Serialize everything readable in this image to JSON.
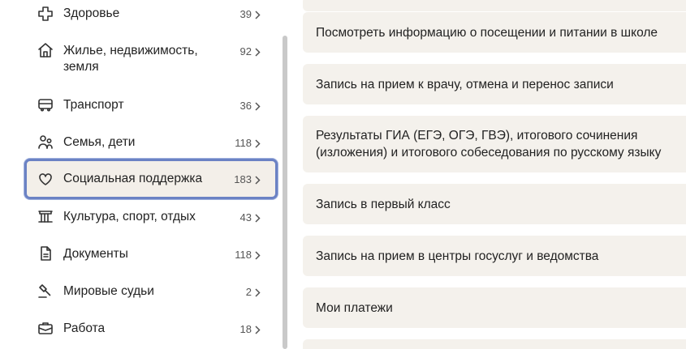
{
  "sidebar": {
    "items": [
      {
        "label": "Здоровье",
        "count": "39",
        "icon": "health-cross-icon"
      },
      {
        "label": "Жилье, недвижимость, земля",
        "count": "92",
        "icon": "house-icon"
      },
      {
        "label": "Транспорт",
        "count": "36",
        "icon": "bus-icon"
      },
      {
        "label": "Семья, дети",
        "count": "118",
        "icon": "family-icon"
      },
      {
        "label": "Социальная поддержка",
        "count": "183",
        "icon": "heart-hand-icon",
        "active": true
      },
      {
        "label": "Культура, спорт, отдых",
        "count": "43",
        "icon": "museum-icon"
      },
      {
        "label": "Документы",
        "count": "118",
        "icon": "document-icon"
      },
      {
        "label": "Мировые судьи",
        "count": "2",
        "icon": "gavel-icon"
      },
      {
        "label": "Работа",
        "count": "18",
        "icon": "briefcase-icon"
      }
    ]
  },
  "services": [
    "Посмотреть информацию о посещении и питании в школе",
    "Запись на прием к врачу, отмена и перенос записи",
    "Результаты ГИА (ЕГЭ, ОГЭ, ГВЭ), итогового сочинения (изложения) и итогового собеседования по русскому языку",
    "Запись в первый класс",
    "Запись на прием в центры госуслуг и ведомства",
    "Мои платежи"
  ],
  "colors": {
    "active_border": "#6b82c4",
    "card_bg": "#f4f1ec"
  }
}
